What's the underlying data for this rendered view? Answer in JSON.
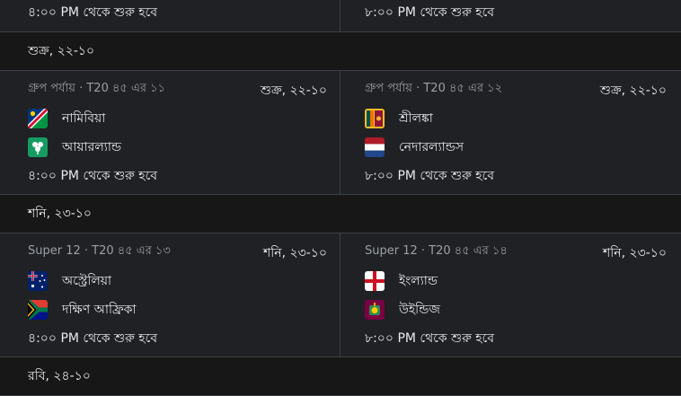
{
  "top_partial": {
    "left_time": "৪:০০ PM থেকে শুরু হবে",
    "right_time": "৮:০০ PM থেকে শুরু হবে"
  },
  "days": [
    {
      "header": "শুক্র, ২২-১০",
      "matches": [
        {
          "meta": "গ্রুপ পর্যায় · T20 ৪৫ এর ১১",
          "date": "শুক্র, ২২-১০",
          "team1": {
            "name": "নামিবিয়া",
            "flag": "namibia-flag-icon"
          },
          "team2": {
            "name": "আয়ারল্যান্ড",
            "flag": "ireland-cricket-flag-icon"
          },
          "time": "৪:০০ PM থেকে শুরু হবে"
        },
        {
          "meta": "গ্রুপ পর্যায় · T20 ৪৫ এর ১২",
          "date": "শুক্র, ২২-১০",
          "team1": {
            "name": "শ্রীলঙ্কা",
            "flag": "sri-lanka-flag-icon"
          },
          "team2": {
            "name": "নেদারল্যান্ডস",
            "flag": "netherlands-flag-icon"
          },
          "time": "৮:০০ PM থেকে শুরু হবে"
        }
      ]
    },
    {
      "header": "শনি, ২৩-১০",
      "matches": [
        {
          "meta": "Super 12 · T20 ৪৫ এর ১৩",
          "date": "শনি, ২৩-১০",
          "team1": {
            "name": "অস্ট্রেলিয়া",
            "flag": "australia-flag-icon"
          },
          "team2": {
            "name": "দক্ষিণ আফ্রিকা",
            "flag": "south-africa-flag-icon"
          },
          "time": "৪:০০ PM থেকে শুরু হবে"
        },
        {
          "meta": "Super 12 · T20 ৪৫ এর ১৪",
          "date": "শনি, ২৩-১০",
          "team1": {
            "name": "ইংল্যান্ড",
            "flag": "england-flag-icon"
          },
          "team2": {
            "name": "উইন্ডিজ",
            "flag": "west-indies-flag-icon"
          },
          "time": "৮:০০ PM থেকে শুরু হবে"
        }
      ]
    },
    {
      "header": "রবি, ২৪-১০",
      "matches": []
    }
  ]
}
